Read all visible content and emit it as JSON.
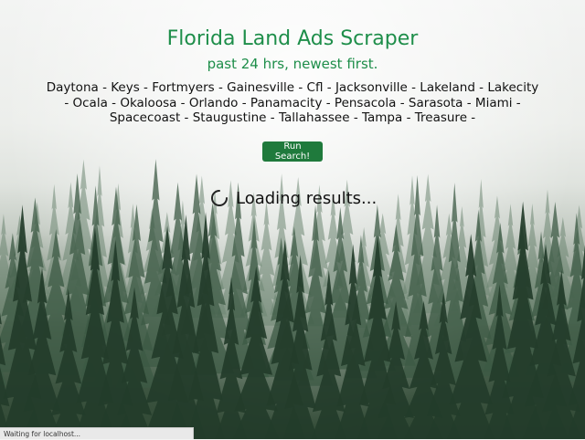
{
  "header": {
    "title": "Florida Land Ads Scraper",
    "subtitle": "past 24 hrs, newest first."
  },
  "cities": [
    "Daytona",
    "Keys",
    "Fortmyers",
    "Gainesville",
    "Cfl",
    "Jacksonville",
    "Lakeland",
    "Lakecity",
    "Ocala",
    "Okaloosa",
    "Orlando",
    "Panamacity",
    "Pensacola",
    "Sarasota",
    "Miami",
    "Spacecoast",
    "Staugustine",
    "Tallahassee",
    "Tampa",
    "Treasure"
  ],
  "separator": " - ",
  "actions": {
    "run_label": "Run Search!"
  },
  "loading": {
    "text": "Loading results..."
  },
  "status_bar": {
    "text": "Waiting for localhost..."
  },
  "colors": {
    "accent": "#1e8e4a",
    "button": "#1f7a3c"
  }
}
